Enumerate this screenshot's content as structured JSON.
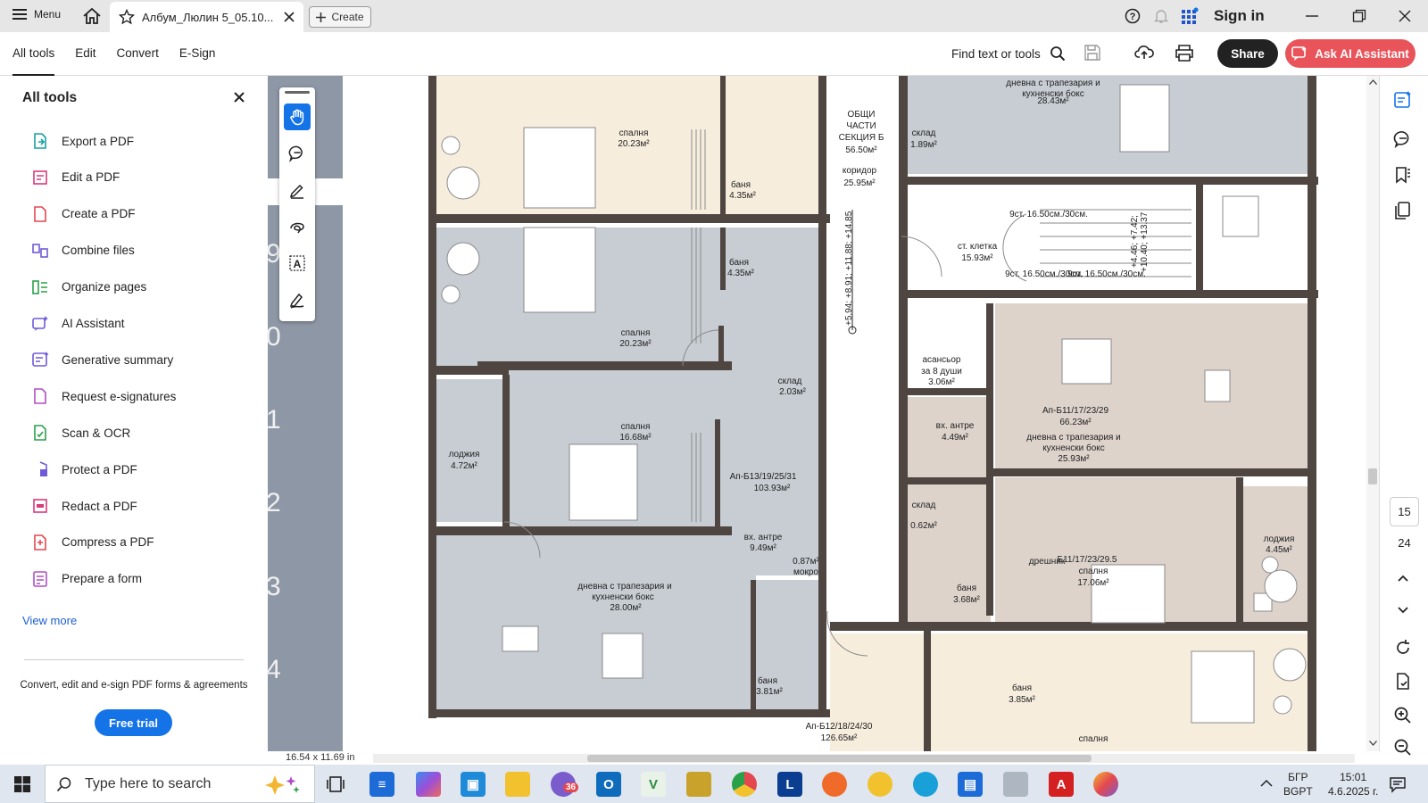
{
  "titlebar": {
    "menu_label": "Menu",
    "tab_title": "Албум_Люлин 5_05.10...",
    "create_label": "Create",
    "signin_label": "Sign in"
  },
  "toolbar": {
    "tabs": [
      "All tools",
      "Edit",
      "Convert",
      "E-Sign"
    ],
    "find_label": "Find text or tools",
    "share_label": "Share",
    "ai_label": "Ask AI Assistant"
  },
  "panel": {
    "title": "All tools",
    "tools": [
      {
        "label": "Export a PDF",
        "color": "#18a0a0"
      },
      {
        "label": "Edit a PDF",
        "color": "#d93b7a"
      },
      {
        "label": "Create a PDF",
        "color": "#e34850"
      },
      {
        "label": "Combine files",
        "color": "#6e5bd8"
      },
      {
        "label": "Organize pages",
        "color": "#2ba04b"
      },
      {
        "label": "AI Assistant",
        "color": "#6e5bd8"
      },
      {
        "label": "Generative summary",
        "color": "#6e5bd8"
      },
      {
        "label": "Request e-signatures",
        "color": "#b04fc4"
      },
      {
        "label": "Scan & OCR",
        "color": "#2ba04b"
      },
      {
        "label": "Protect a PDF",
        "color": "#6e5bd8"
      },
      {
        "label": "Redact a PDF",
        "color": "#d93b7a"
      },
      {
        "label": "Compress a PDF",
        "color": "#e34850"
      },
      {
        "label": "Prepare a form",
        "color": "#b04fc4"
      }
    ],
    "view_more": "View more",
    "promo_text": "Convert, edit and e-sign PDF forms & agreements",
    "trial_label": "Free trial"
  },
  "thumbs": {
    "numbers": [
      "9",
      "0",
      "1",
      "2",
      "3",
      "4"
    ]
  },
  "plan": {
    "rooms": [
      "спалня",
      "20.23м²",
      "баня",
      "4.35м²",
      "спалня",
      "20.23м²",
      "баня",
      "4.35м²",
      "склад",
      "2.03м²",
      "лоджия",
      "4.72м²",
      "спалня",
      "16.68м²",
      "Ап-Б13/19/25/31",
      "103.93м²",
      "вх. антре",
      "9.49м²",
      "0.87м²",
      "мокро",
      "дневна с трапезария и",
      "кухненски бокс",
      "28.00м²",
      "баня",
      "3.81м²",
      "ОБЩИ",
      "ЧАСТИ",
      "СЕКЦИЯ Б",
      "56.50м²",
      "коридор",
      "25.95м²",
      "склад",
      "1.89м²",
      "дневна с трапезария и",
      "кухненски бокс",
      "28.43м²",
      "ст. клетка",
      "15.93м²",
      "асансьор",
      "за 8 души",
      "3.06м²",
      "Ап-Б11/17/23/29",
      "66.23м²",
      "вх. антре",
      "4.49м²",
      "дневна с трапезария и",
      "кухненски бокс",
      "25.93м²",
      "склад",
      "0.62м²",
      "баня",
      "3.68м²",
      "дрешник",
      "Б11/17/23/29.5",
      "спалня",
      "17.06м²",
      "лоджия",
      "4.45м²",
      "баня",
      "3.85м²",
      "Ап-Б12/18/24/30",
      "126.65м²",
      "спалня"
    ],
    "levels": "+5.94; +8.91; +11.88; +14.85",
    "levels2": "+4.46; +7.42;",
    "levels3": "+10.40; +13.37",
    "stairs1": "9ст. 16.50см./30см.",
    "stairs2": "9ст. 16.50см./30см.",
    "stairs3": "9ст. 16.50см./30см."
  },
  "rail": {
    "page_current": "15",
    "page_total": "24"
  },
  "status": {
    "page_size": "16.54 x 11.69 in"
  },
  "taskbar": {
    "search_placeholder": "Type here to search",
    "badge": "36",
    "lang_top": "БГР",
    "lang_bottom": "BGPT",
    "time": "15:01",
    "date": "4.6.2025 г."
  }
}
